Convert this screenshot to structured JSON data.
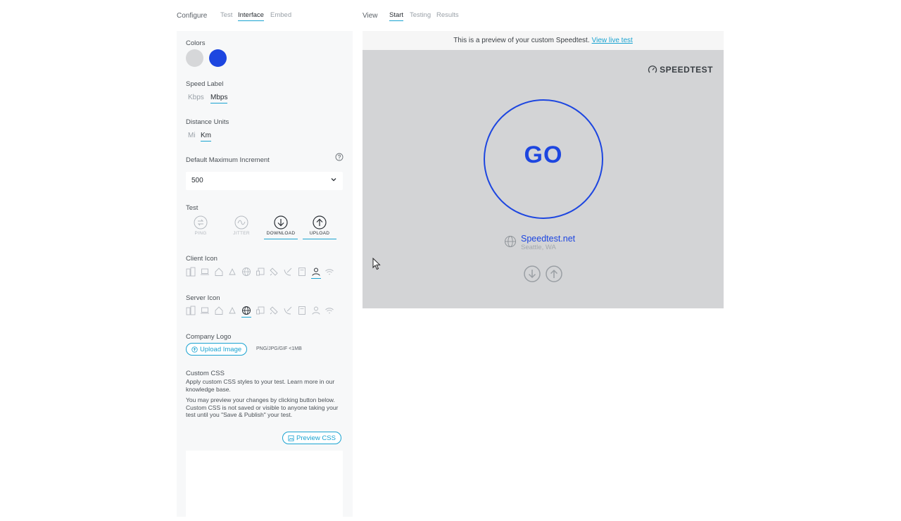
{
  "configure": {
    "label": "Configure",
    "tabs": [
      {
        "label": "Test",
        "active": false
      },
      {
        "label": "Interface",
        "active": true
      },
      {
        "label": "Embed",
        "active": false
      }
    ]
  },
  "view": {
    "label": "View",
    "tabs": [
      {
        "label": "Start",
        "active": true
      },
      {
        "label": "Testing",
        "active": false
      },
      {
        "label": "Results",
        "active": false
      }
    ]
  },
  "settings": {
    "colors": {
      "label": "Colors",
      "swatches": [
        "#d6d7d9",
        "#1d46e0"
      ]
    },
    "speed_label": {
      "label": "Speed Label",
      "options": [
        "Kbps",
        "Mbps"
      ],
      "selected": "Mbps"
    },
    "distance_units": {
      "label": "Distance Units",
      "options": [
        "Mi",
        "Km"
      ],
      "selected": "Km"
    },
    "max_increment": {
      "label": "Default Maximum Increment",
      "value": "500",
      "help_icon": "question-circle-icon"
    },
    "test": {
      "label": "Test",
      "options": [
        {
          "label": "PING",
          "icon": "ping-icon",
          "enabled": false
        },
        {
          "label": "JITTER",
          "icon": "jitter-icon",
          "enabled": false
        },
        {
          "label": "DOWNLOAD",
          "icon": "download-icon",
          "enabled": true
        },
        {
          "label": "UPLOAD",
          "icon": "upload-icon",
          "enabled": true
        }
      ]
    },
    "client_icon": {
      "label": "Client Icon",
      "icons": [
        "building-icon",
        "laptop-icon",
        "home-icon",
        "cloud-icon",
        "globe-icon",
        "devices-icon",
        "satellite-icon",
        "satellite-dish-icon",
        "server-icon",
        "person-icon",
        "wifi-icon"
      ],
      "selected_index": 9
    },
    "server_icon": {
      "label": "Server Icon",
      "icons": [
        "building-icon",
        "laptop-icon",
        "home-icon",
        "cloud-icon",
        "globe-icon",
        "devices-icon",
        "satellite-icon",
        "satellite-dish-icon",
        "server-icon",
        "person-icon",
        "wifi-icon"
      ],
      "selected_index": 4
    },
    "company_logo": {
      "label": "Company Logo",
      "button": "Upload Image",
      "note": "PNG/JPG/GIF <1MB"
    },
    "custom_css": {
      "label": "Custom CSS",
      "para1": "Apply custom CSS styles to your test. Learn more in our knowledge base.",
      "para2": "You may preview your changes by clicking button below. Custom CSS is not saved or visible to anyone taking your test until you \"Save & Publish\" your test.",
      "button": "Preview CSS"
    }
  },
  "preview": {
    "banner_text": "This is a preview of your custom Speedtest.",
    "banner_link": "View live test",
    "logo_text": "SPEEDTEST",
    "go_label": "GO",
    "server_name": "Speedtest.net",
    "server_location": "Seattle, WA",
    "colors": {
      "accent": "#1d46e0",
      "link": "#1aa3d1",
      "background": "#d3d4d6"
    }
  }
}
